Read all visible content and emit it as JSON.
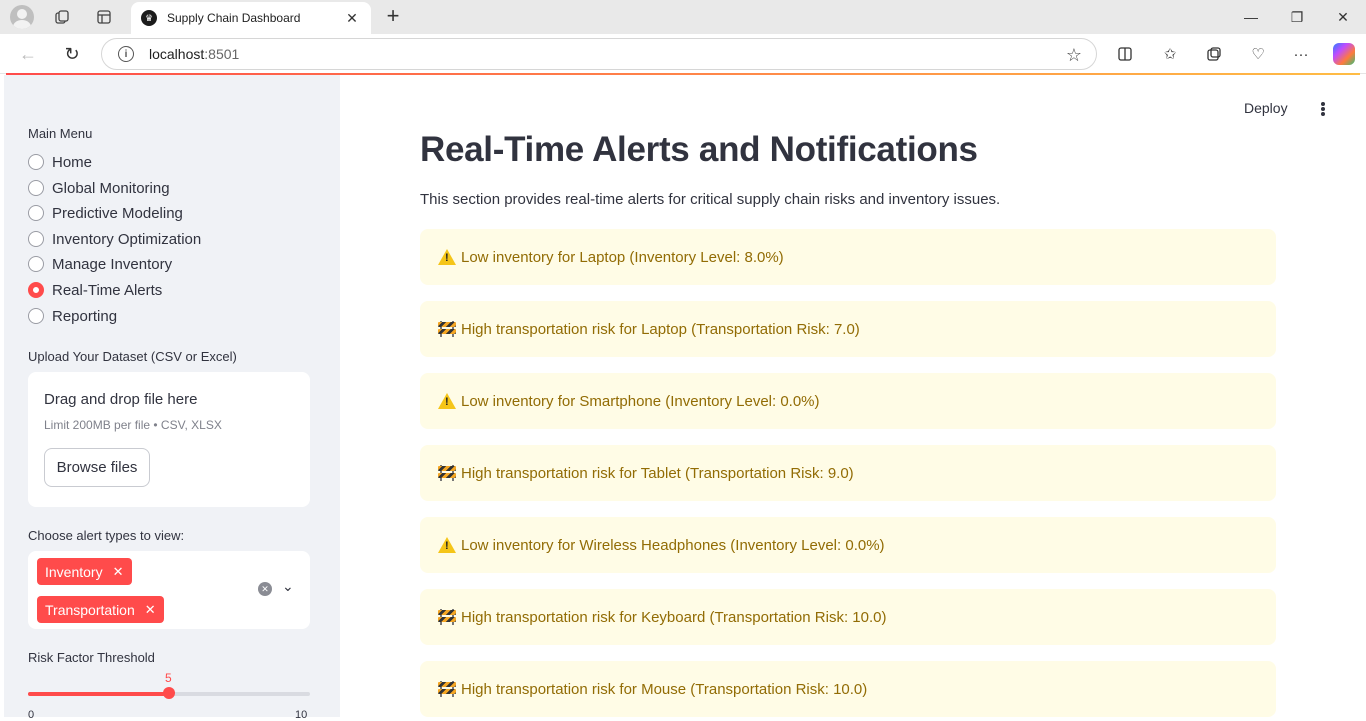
{
  "browser": {
    "tab_title": "Supply Chain Dashboard",
    "url_host": "localhost",
    "url_port": ":8501"
  },
  "sidebar": {
    "menu_label": "Main Menu",
    "menu_items": [
      {
        "label": "Home",
        "selected": false
      },
      {
        "label": "Global Monitoring",
        "selected": false
      },
      {
        "label": "Predictive Modeling",
        "selected": false
      },
      {
        "label": "Inventory Optimization",
        "selected": false
      },
      {
        "label": "Manage Inventory",
        "selected": false
      },
      {
        "label": "Real-Time Alerts",
        "selected": true
      },
      {
        "label": "Reporting",
        "selected": false
      }
    ],
    "upload": {
      "label": "Upload Your Dataset (CSV or Excel)",
      "drop_text": "Drag and drop file here",
      "limit_text": "Limit 200MB per file • CSV, XLSX",
      "browse_label": "Browse files"
    },
    "alert_types": {
      "label": "Choose alert types to view:",
      "chips": [
        "Inventory",
        "Transportation"
      ]
    },
    "threshold": {
      "label": "Risk Factor Threshold",
      "value": "5",
      "min": "0",
      "max": "10",
      "fraction": 0.5
    }
  },
  "header": {
    "deploy_label": "Deploy"
  },
  "main": {
    "title": "Real-Time Alerts and Notifications",
    "description": "This section provides real-time alerts for critical supply chain risks and inventory issues.",
    "alerts": [
      {
        "icon": "warning-icon",
        "text": "Low inventory for Laptop (Inventory Level: 8.0%)"
      },
      {
        "icon": "construction-barrier-icon",
        "text": "High transportation risk for Laptop (Transportation Risk: 7.0)"
      },
      {
        "icon": "warning-icon",
        "text": "Low inventory for Smartphone (Inventory Level: 0.0%)"
      },
      {
        "icon": "construction-barrier-icon",
        "text": "High transportation risk for Tablet (Transportation Risk: 9.0)"
      },
      {
        "icon": "warning-icon",
        "text": "Low inventory for Wireless Headphones (Inventory Level: 0.0%)"
      },
      {
        "icon": "construction-barrier-icon",
        "text": "High transportation risk for Keyboard (Transportation Risk: 10.0)"
      },
      {
        "icon": "construction-barrier-icon",
        "text": "High transportation risk for Mouse (Transportation Risk: 10.0)"
      }
    ]
  }
}
